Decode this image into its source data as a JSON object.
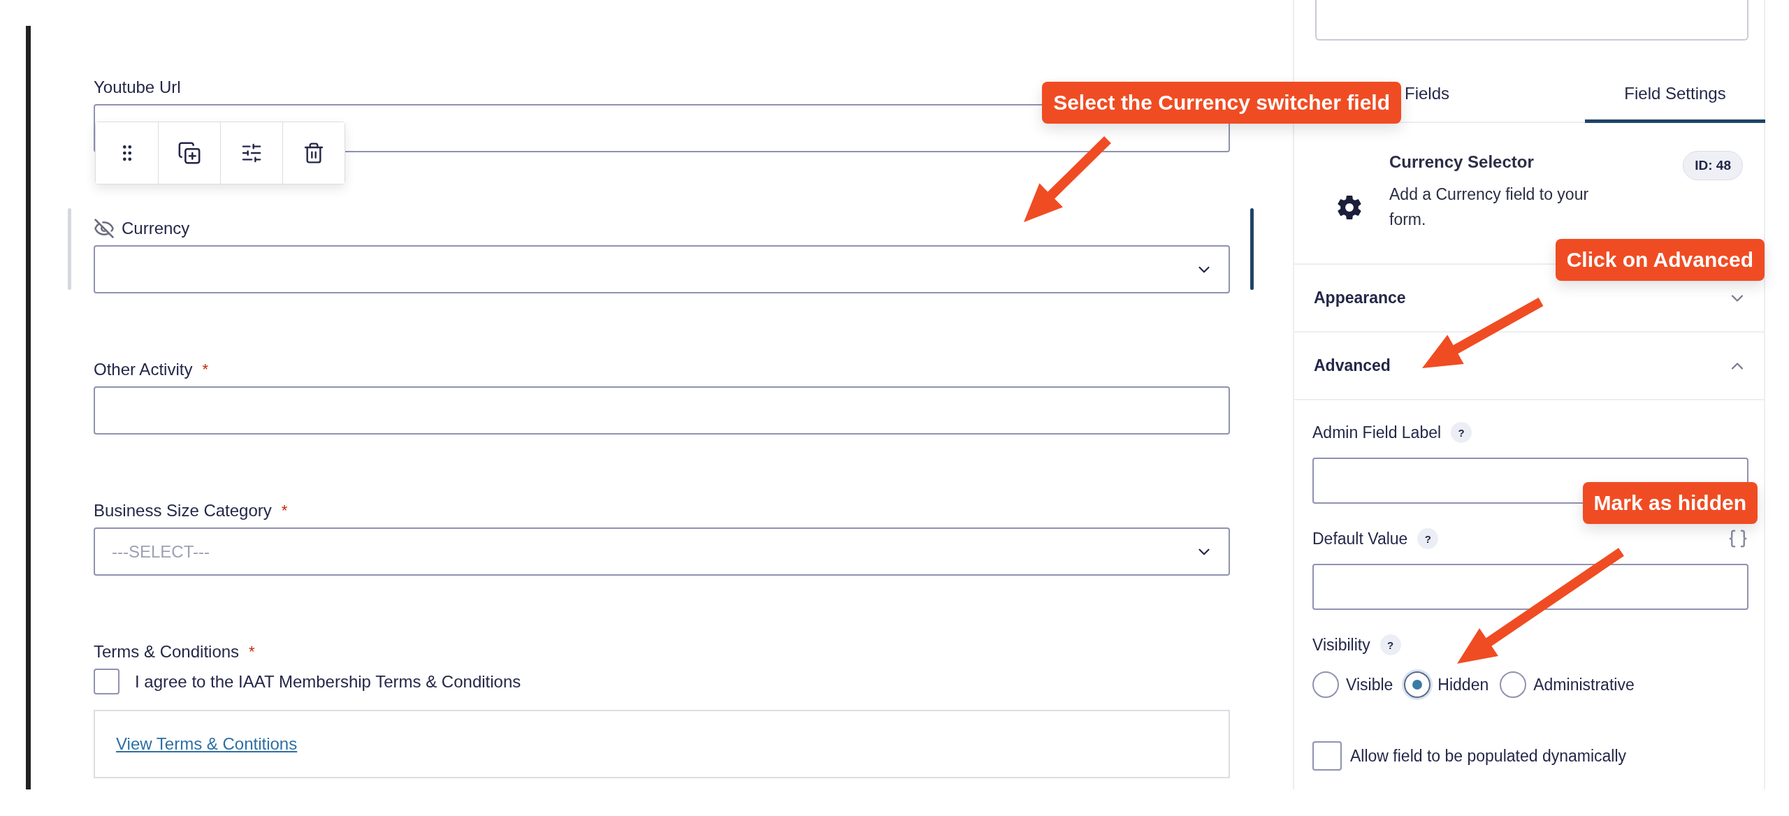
{
  "form_fields": [
    {
      "kind": "text",
      "label": "Youtube Url",
      "selected": false,
      "hidden": false
    },
    {
      "kind": "select",
      "label": "Currency",
      "selected": true,
      "hidden": true
    },
    {
      "kind": "text",
      "label": "Other Activity",
      "required_mark": "*",
      "selected": false,
      "hidden": false
    },
    {
      "kind": "select",
      "label": "Business Size Category",
      "required_mark": "*",
      "placeholder": "---SELECT---",
      "selected": false,
      "hidden": false
    },
    {
      "kind": "consent",
      "label": "Terms & Conditions",
      "required_mark": "*",
      "checkbox_label": "I agree to the IAAT Membership Terms & Conditions",
      "checked": false,
      "link": "View Terms & Contitions",
      "selected": false,
      "hidden": false
    }
  ],
  "settings_panel": {
    "tabs": [
      {
        "label": "Fields",
        "selected": false
      },
      {
        "label": "Field Settings",
        "selected": true
      }
    ],
    "field_info": {
      "title": "Currency Selector",
      "description": "Add a Currency field to your form.",
      "id_badge": "ID: 48"
    },
    "sections": [
      {
        "title": "Appearance",
        "expanded": false
      },
      {
        "title": "Advanced",
        "expanded": true
      }
    ],
    "advanced": {
      "admin_field_label": {
        "label": "Admin Field Label",
        "help": "?"
      },
      "default_value": {
        "label": "Default Value",
        "help": "?"
      },
      "visibility": {
        "label": "Visibility",
        "help": "?",
        "options": [
          {
            "label": "Visible",
            "selected": false
          },
          {
            "label": "Hidden",
            "selected": true
          },
          {
            "label": "Administrative",
            "selected": false
          }
        ]
      },
      "dynamic_population": {
        "label": "Allow field to be populated dynamically",
        "checked": false
      }
    }
  },
  "annotations": [
    {
      "text": "Select the Currency switcher field"
    },
    {
      "text": "Click on Advanced"
    },
    {
      "text": "Mark as hidden"
    }
  ]
}
